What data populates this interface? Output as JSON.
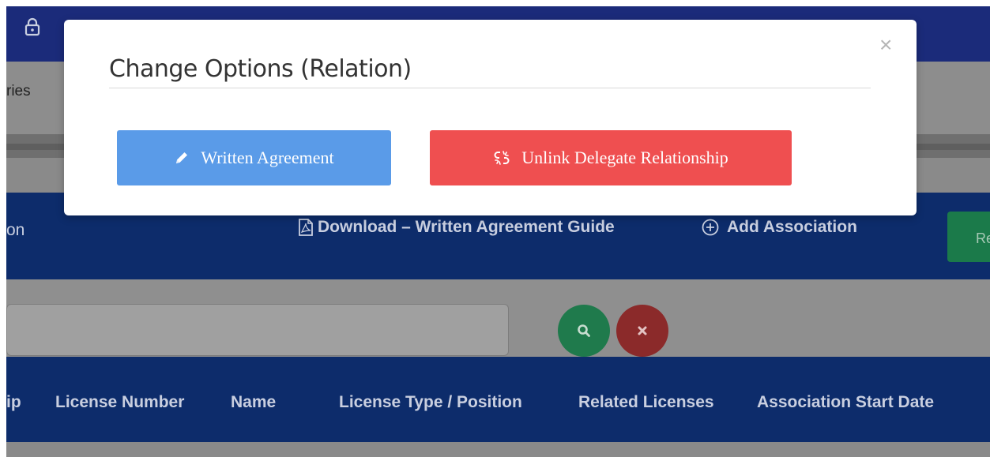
{
  "modal": {
    "title": "Change Options (Relation)",
    "close_label": "×",
    "buttons": {
      "written_agreement": "Written Agreement",
      "unlink": "Unlink Delegate Relationship"
    }
  },
  "background": {
    "subnav_fragment": "ries",
    "action_fragment": "on",
    "download_label": "Download – Written Agreement Guide",
    "add_association_label": "Add Association",
    "right_button_fragment": "Re",
    "table_headers": [
      "ip",
      "License Number",
      "Name",
      "License Type / Position",
      "Related Licenses",
      "Association Start Date"
    ]
  },
  "colors": {
    "modal_blue_button": "#5a9be8",
    "modal_red_button": "#ef4f50",
    "header_navy": "#0d2c6b"
  },
  "icons": [
    "lock-icon",
    "pdf-icon",
    "plus-circle-icon",
    "search-icon",
    "clear-icon",
    "pencil-icon",
    "unlink-icon",
    "close-icon"
  ]
}
